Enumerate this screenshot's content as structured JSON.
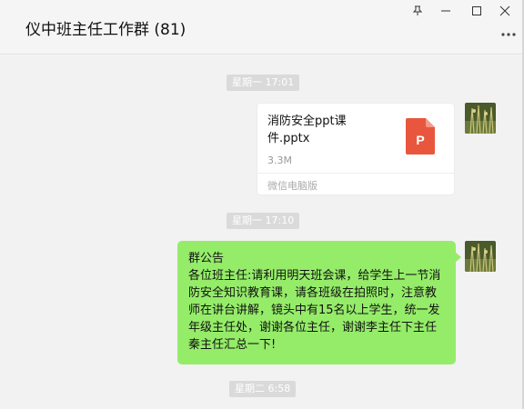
{
  "window": {
    "title": "仪中班主任工作群 (81)",
    "pin_icon": "pin-icon",
    "minimize_icon": "minimize-icon",
    "maximize_icon": "maximize-icon",
    "close_icon": "close-icon",
    "more_icon": "more-dots-icon"
  },
  "messages": {
    "time1": "星期一 17:01",
    "file": {
      "name": "消防安全ppt课件.pptx",
      "size": "3.3M",
      "source": "微信电脑版",
      "icon": "pptx-file-icon",
      "icon_letter": "P",
      "icon_color": "#e8573d"
    },
    "time2": "星期一 17:10",
    "announcement": {
      "heading": "群公告",
      "body": "各位班主任:请利用明天班会课，给学生上一节消防安全知识教育课，请各班级在拍照时，注意教师在讲台讲解，镜头中有15名以上学生，统一发年级主任处，谢谢各位主任，谢谢李主任下主任秦主任汇总一下!"
    },
    "time3": "星期二 6:58"
  },
  "colors": {
    "bubble_green": "#95ec69",
    "background": "#f2f2f2"
  }
}
